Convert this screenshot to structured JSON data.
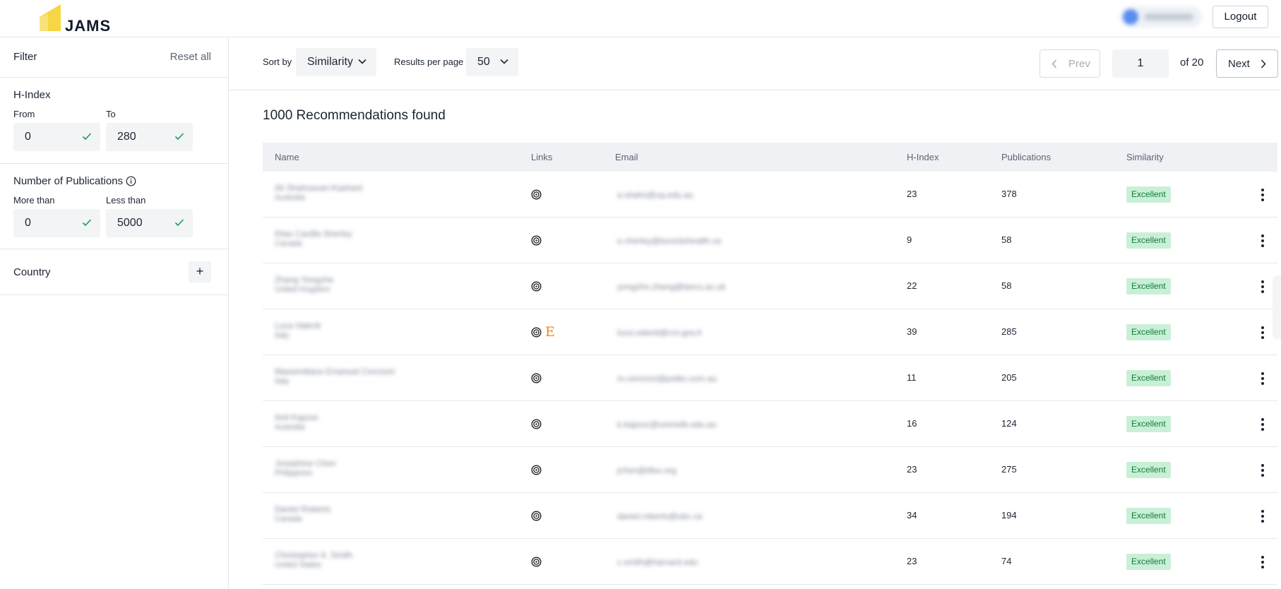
{
  "header": {
    "app_name": "JAMS",
    "logout_label": "Logout"
  },
  "sidebar": {
    "title": "Filter",
    "reset_label": "Reset all",
    "hindex": {
      "title": "H-Index",
      "from_label": "From",
      "to_label": "To",
      "from_value": "0",
      "to_value": "280"
    },
    "publications": {
      "title": "Number of Publications",
      "more_label": "More than",
      "less_label": "Less than",
      "more_value": "0",
      "less_value": "5000"
    },
    "country": {
      "title": "Country",
      "add_symbol": "+"
    }
  },
  "toolbar": {
    "sort_label": "Sort by",
    "sort_value": "Similarity",
    "rpp_label": "Results per page",
    "rpp_value": "50",
    "prev_label": "Prev",
    "page_value": "1",
    "of_text": "of 20",
    "next_label": "Next"
  },
  "results": {
    "title": "1000 Recommendations found",
    "columns": {
      "name": "Name",
      "links": "Links",
      "email": "Email",
      "hindex": "H-Index",
      "publications": "Publications",
      "similarity": "Similarity"
    },
    "rows": [
      {
        "name": "Ali Shahsavari-Kashani",
        "country": "Australia",
        "email": "a.shahs@uq.edu.au",
        "hindex": "23",
        "publications": "378",
        "similarity": "Excellent",
        "orcid_icon": "orcid-icon"
      },
      {
        "name": "Elias Cavilla Sherley",
        "country": "Canada",
        "email": "e.cherley@torontohealth.ca",
        "hindex": "9",
        "publications": "58",
        "similarity": "Excellent",
        "orcid_icon": "orcid-icon"
      },
      {
        "name": "Zhang Yongzhe",
        "country": "United Kingdom",
        "email": "yongzhe.zhang@lancs.ac.uk",
        "hindex": "22",
        "publications": "58",
        "similarity": "Excellent",
        "orcid_icon": "orcid-icon"
      },
      {
        "name": "Luca Valenti",
        "country": "Italy",
        "email": "luca.valenti@cnr.gov.it",
        "hindex": "39",
        "publications": "285",
        "similarity": "Excellent",
        "orcid_icon": "orcid-icon",
        "extra_icon": "E"
      },
      {
        "name": "Massimiliano Emanuel Cencioni",
        "country": "Italy",
        "email": "m.cencioni@polito.com.au",
        "hindex": "11",
        "publications": "205",
        "similarity": "Excellent",
        "orcid_icon": "orcid-icon"
      },
      {
        "name": "Anil Kapoor",
        "country": "Australia",
        "email": "k.kapoor@unimelb.edu.au",
        "hindex": "16",
        "publications": "124",
        "similarity": "Excellent",
        "orcid_icon": "orcid-icon"
      },
      {
        "name": "Josephine Chen",
        "country": "Philippines",
        "email": "jchen@dlsu.org",
        "hindex": "23",
        "publications": "275",
        "similarity": "Excellent",
        "orcid_icon": "orcid-icon"
      },
      {
        "name": "Daniel Roberts",
        "country": "Canada",
        "email": "daniel.roberts@ubc.ca",
        "hindex": "34",
        "publications": "194",
        "similarity": "Excellent",
        "orcid_icon": "orcid-icon"
      },
      {
        "name": "Christopher A. Smith",
        "country": "United States",
        "email": "c.smith@harvard.edu",
        "hindex": "23",
        "publications": "74",
        "similarity": "Excellent",
        "orcid_icon": "orcid-icon"
      }
    ]
  },
  "colors": {
    "badge_bg": "#c9f0d6",
    "badge_text": "#137a3d",
    "accent_logo": "#f6d743",
    "e_icon": "#f08a1a"
  }
}
